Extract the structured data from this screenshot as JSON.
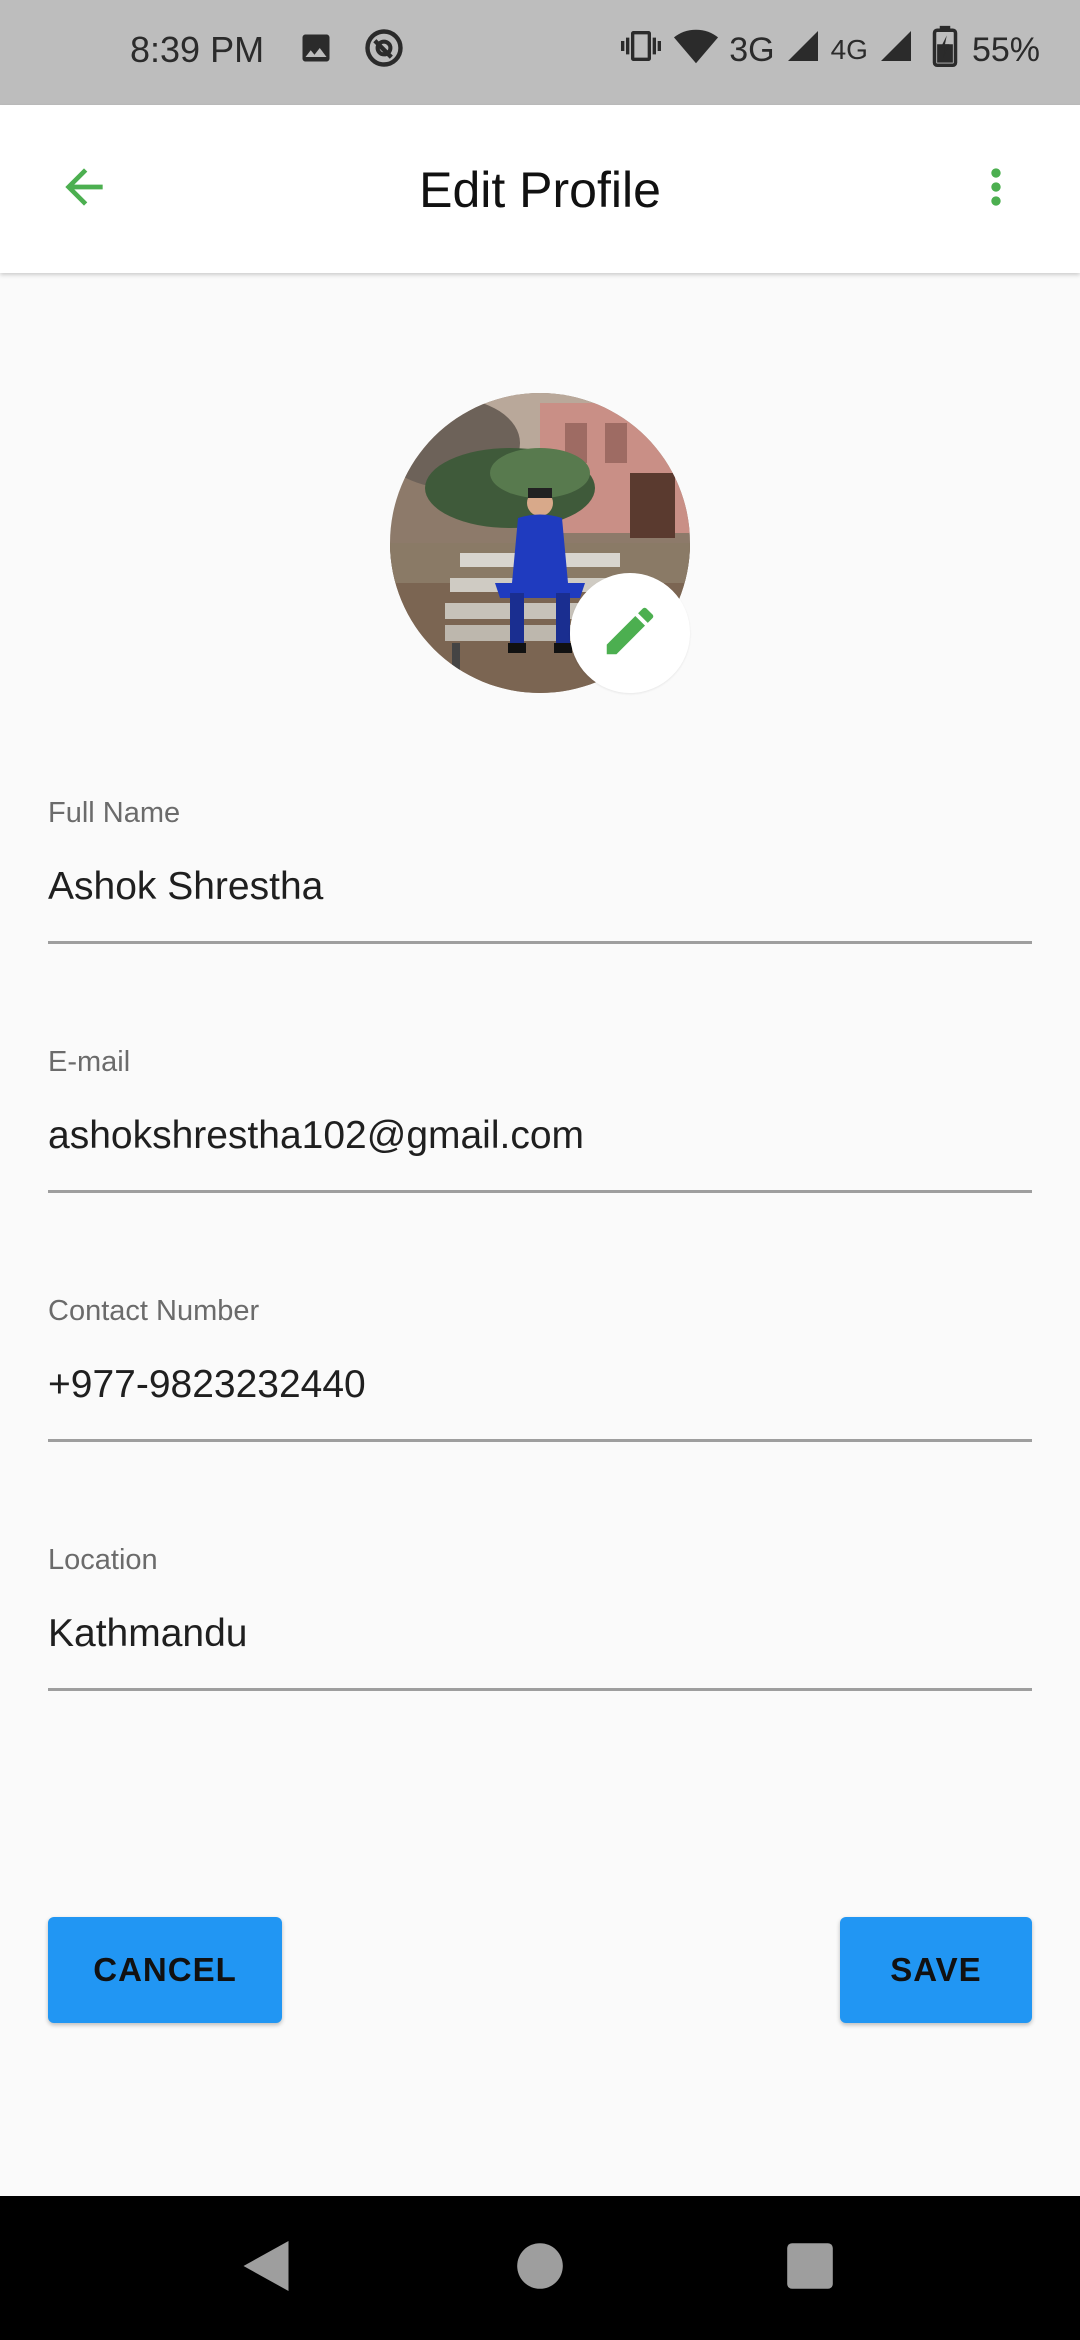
{
  "status_bar": {
    "time": "8:39 PM",
    "network_3g": "3G",
    "network_4g": "4G",
    "battery": "55%",
    "left_icons": [
      "image-icon",
      "sync-icon"
    ],
    "right_icons": [
      "vibrate-icon",
      "wifi-icon",
      "signal-icon",
      "signal-icon",
      "battery-charging-icon"
    ]
  },
  "app_bar": {
    "title": "Edit Profile",
    "back_icon": "arrow-back-icon",
    "menu_icon": "more-vert-icon"
  },
  "avatar": {
    "edit_icon": "pencil-icon"
  },
  "form": {
    "fields": [
      {
        "label": "Full Name",
        "value": "Ashok Shrestha"
      },
      {
        "label": "E-mail",
        "value": "ashokshrestha102@gmail.com"
      },
      {
        "label": "Contact Number",
        "value": "+977-9823232440"
      },
      {
        "label": "Location",
        "value": "Kathmandu"
      }
    ]
  },
  "actions": {
    "cancel_label": "CANCEL",
    "save_label": "SAVE"
  },
  "colors": {
    "accent_green": "#4caf50",
    "button_blue": "#2196f3",
    "status_bar_bg": "#bdbdbd",
    "background": "#fafafa"
  }
}
